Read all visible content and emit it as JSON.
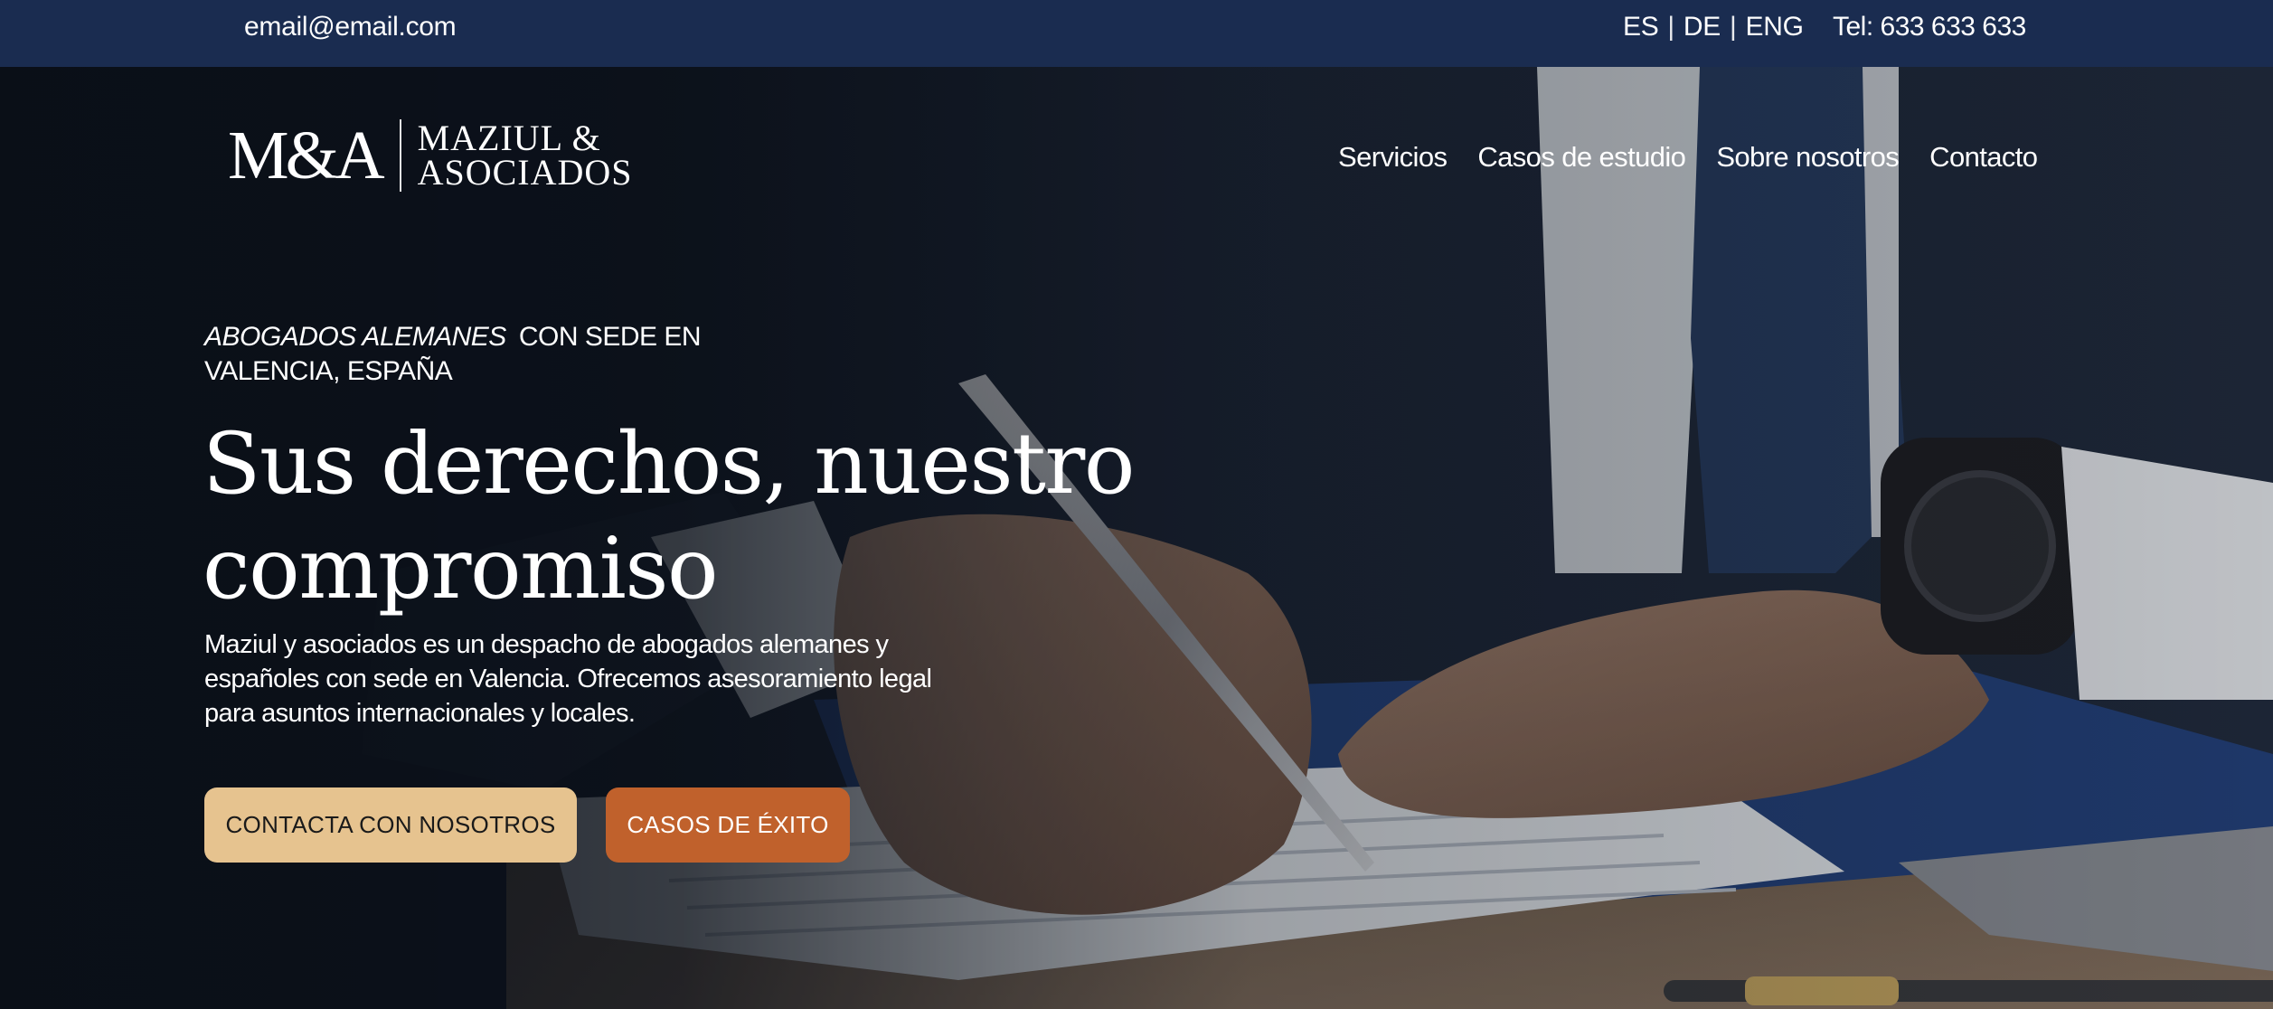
{
  "topbar": {
    "email": "email@email.com",
    "languages": [
      "ES",
      "DE",
      "ENG"
    ],
    "separator": "|",
    "phone": "Tel: 633 633 633"
  },
  "logo": {
    "mark": "M&A",
    "name_line1": "MAZIUL &",
    "name_line2": "ASOCIADOS"
  },
  "nav": {
    "items": [
      {
        "label": "Servicios"
      },
      {
        "label": "Casos de estudio"
      },
      {
        "label": "Sobre nosotros"
      },
      {
        "label": "Contacto"
      }
    ]
  },
  "hero": {
    "eyebrow_italic": "ABOGADOS ALEMANES",
    "eyebrow_rest": "CON SEDE EN VALENCIA, ESPAÑA",
    "headline": "Sus derechos, nuestro compromiso",
    "description": "Maziul y asociados es un despacho de abogados alemanes y españoles con sede en Valencia. Ofrecemos asesoramiento legal para asuntos internacionales y locales.",
    "primary_button": "CONTACTA CON NOSOTROS",
    "secondary_button": "CASOS DE ÉXITO"
  },
  "colors": {
    "topbar_bg": "#1a2c50",
    "primary_button": "#e6c38f",
    "secondary_button": "#c0612c",
    "text": "#ffffff"
  }
}
